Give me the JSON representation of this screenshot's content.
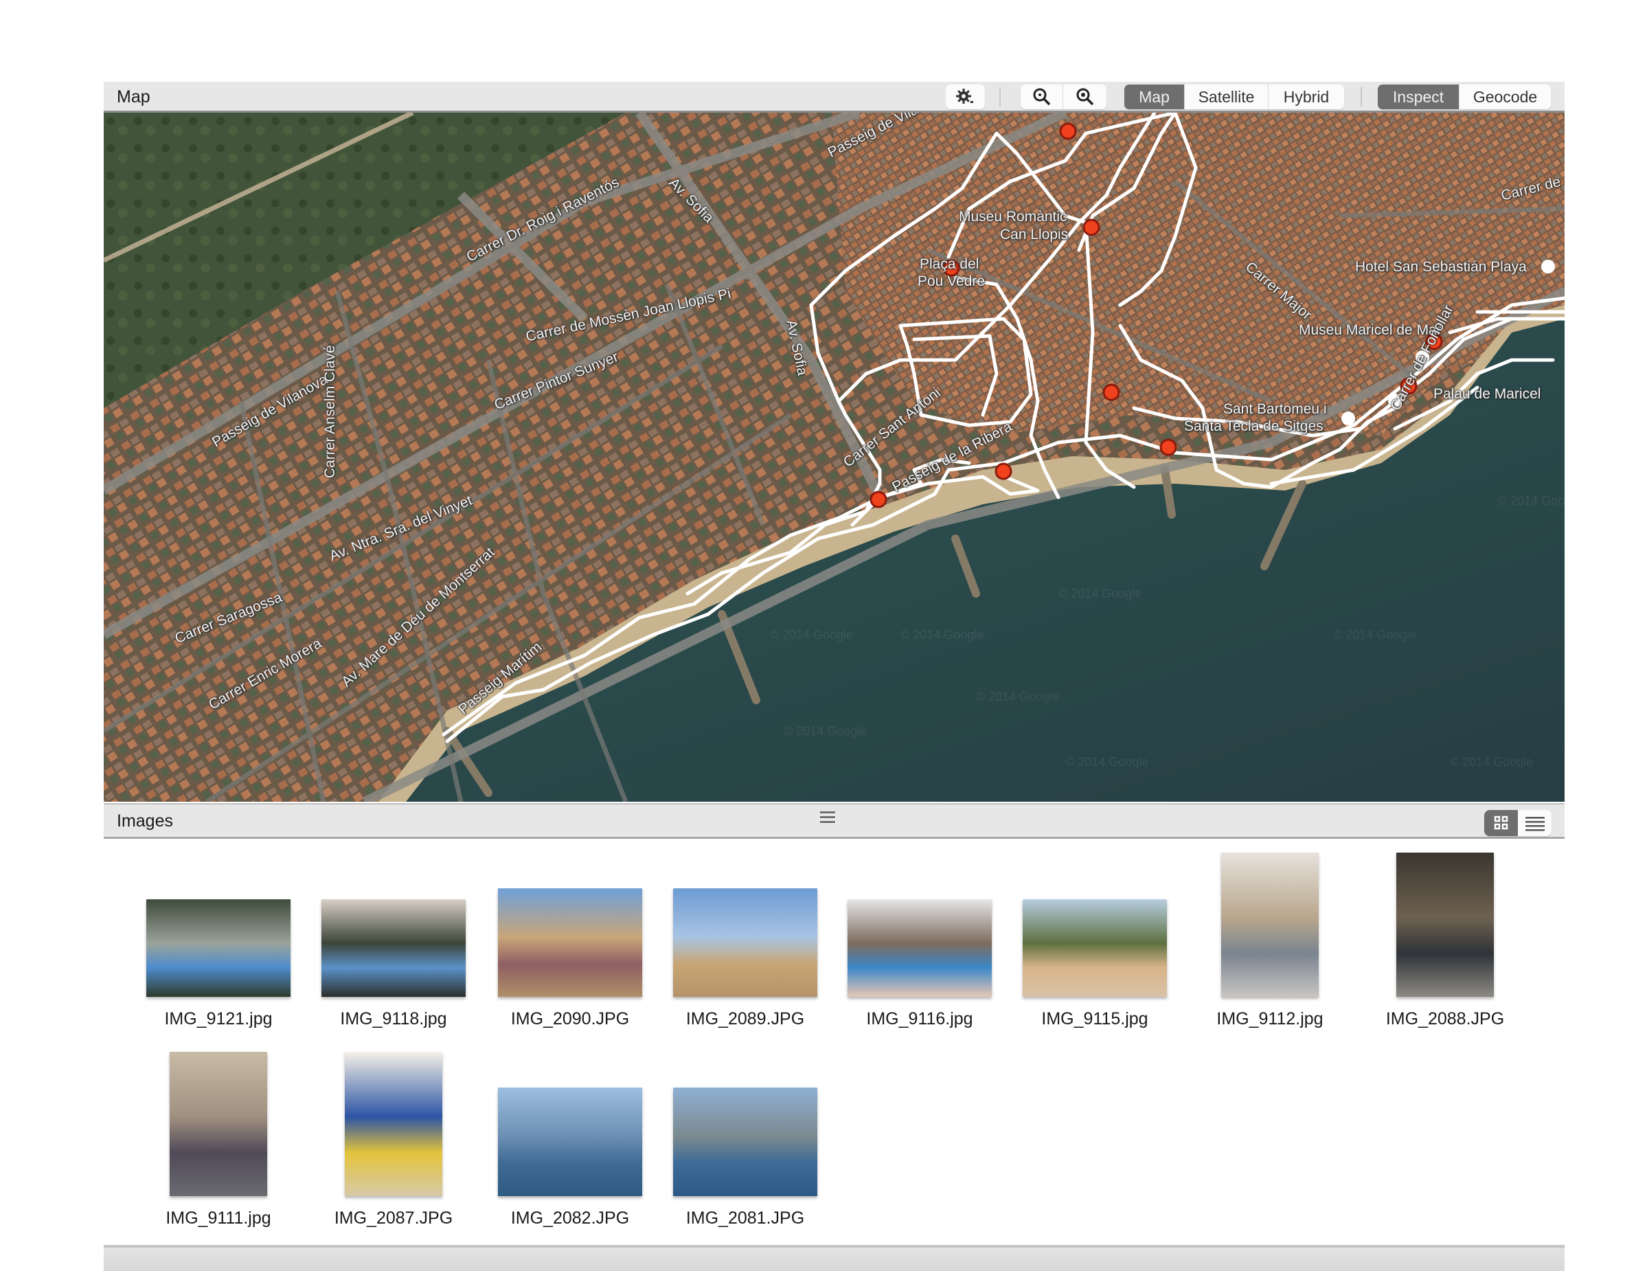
{
  "map_panel": {
    "title": "Map",
    "toolbar": {
      "settings_icon": "gear-icon",
      "zoom_out_icon": "zoom-out-icon",
      "zoom_in_icon": "zoom-in-icon",
      "map_types": [
        {
          "label": "Map",
          "active": true
        },
        {
          "label": "Satellite",
          "active": false
        },
        {
          "label": "Hybrid",
          "active": false
        }
      ],
      "modes": [
        {
          "label": "Inspect",
          "active": true
        },
        {
          "label": "Geocode",
          "active": false
        }
      ]
    },
    "labels": {
      "l1": "Passeig de Vilanova",
      "l2": "Carrer Dr. Roig i Raventós",
      "l3": "Av. Sofia",
      "l4": "Passeig de Vilanova",
      "l5": "Carrer de Mossèn Joan Llopis Pi",
      "l6": "Carrer Pintor Sunyer",
      "l7": "Av. Sofia",
      "l8": "Carrer Anselm Clavé",
      "l9": "Av. Ntra. Sra. del Vinyet",
      "l10": "Carrer Saragossa",
      "l11": "Carrer Enric Morera",
      "l12": "Av. Mare de Déu de Montserrat",
      "l13": "Passeig Marítim",
      "l14": "Carrer Sant Antoni",
      "l15": "Passeig de la Ribera",
      "l16": "Museu Romàntic",
      "l16b": "Can Llopis",
      "l17": "Plaça del",
      "l17b": "Pou Vedre",
      "l18": "Hotel San Sebastián Playa",
      "l19": "Carrer Major",
      "l20": "Museu Maricel de Mar",
      "l21": "Palau de Maricel",
      "l22": "Sant Bartomeu i",
      "l23": "Santa Tecla de Sitges",
      "l24": "Carrer de",
      "l25": "Carrer de Fonollar",
      "watermark": "© 2014 Google"
    },
    "photo_marker_color": "#e8401c",
    "track_color": "#ffffff"
  },
  "images_panel": {
    "title": "Images",
    "view_modes": [
      {
        "name": "grid",
        "active": true
      },
      {
        "name": "list",
        "active": false
      }
    ],
    "images": [
      {
        "filename": "IMG_9121.jpg",
        "orientation": "landscape",
        "colors": [
          "#3e4a3a",
          "#9aa39a",
          "#4e8ccd",
          "#2d3a2a"
        ]
      },
      {
        "filename": "IMG_9118.jpg",
        "orientation": "landscape",
        "colors": [
          "#d8cfc6",
          "#3c4438",
          "#5c92c9",
          "#2a2f2a"
        ]
      },
      {
        "filename": "IMG_2090.JPG",
        "orientation": "landscape-tall",
        "colors": [
          "#6fa0d8",
          "#c9a679",
          "#8f5f63",
          "#b08f68"
        ]
      },
      {
        "filename": "IMG_2089.JPG",
        "orientation": "landscape-tall",
        "colors": [
          "#6d9bd3",
          "#a8c4e3",
          "#c8a574",
          "#b5936a"
        ]
      },
      {
        "filename": "IMG_9116.jpg",
        "orientation": "landscape",
        "colors": [
          "#e6e6e6",
          "#7d6b5d",
          "#3b87c8",
          "#e8c7b5"
        ]
      },
      {
        "filename": "IMG_9115.jpg",
        "orientation": "landscape",
        "colors": [
          "#b7cde0",
          "#5d7040",
          "#d9b48a",
          "#d7c2a6"
        ]
      },
      {
        "filename": "IMG_9112.jpg",
        "orientation": "portrait",
        "colors": [
          "#e6e2dc",
          "#b9a78d",
          "#7a8490",
          "#c9c5c2"
        ]
      },
      {
        "filename": "IMG_2088.JPG",
        "orientation": "portrait",
        "colors": [
          "#3a3630",
          "#6e6150",
          "#2f3338",
          "#8d8a84"
        ]
      },
      {
        "filename": "IMG_9111.jpg",
        "orientation": "portrait",
        "colors": [
          "#c8bba6",
          "#a09080",
          "#504a58",
          "#6b6a70"
        ]
      },
      {
        "filename": "IMG_2087.JPG",
        "orientation": "portrait",
        "colors": [
          "#f5f1e8",
          "#2d54a4",
          "#e4c33c",
          "#d7c9a8"
        ]
      },
      {
        "filename": "IMG_2082.JPG",
        "orientation": "landscape-tall",
        "colors": [
          "#9dbfdf",
          "#6b8fb3",
          "#3e6a94",
          "#2f5a82"
        ]
      },
      {
        "filename": "IMG_2081.JPG",
        "orientation": "landscape-tall",
        "colors": [
          "#8fb0d3",
          "#7a8a8f",
          "#3d6a98",
          "#2c5986"
        ]
      }
    ]
  }
}
